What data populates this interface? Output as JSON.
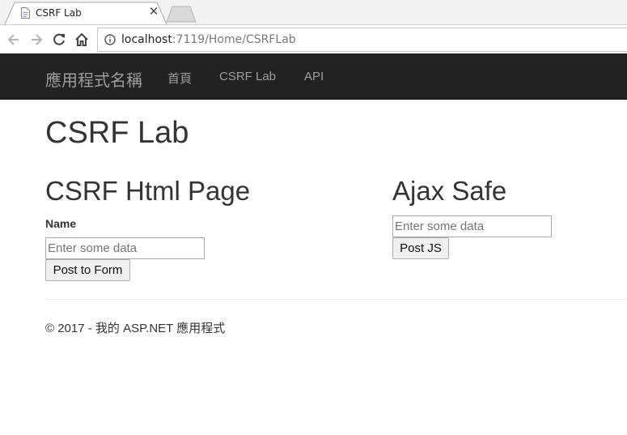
{
  "browser": {
    "tab_title": "CSRF Lab",
    "url_host": "localhost",
    "url_path": ":7119/Home/CSRFLab"
  },
  "navbar": {
    "brand": "應用程式名稱",
    "links": [
      {
        "label": "首頁"
      },
      {
        "label": "CSRF Lab"
      },
      {
        "label": "API"
      }
    ]
  },
  "main": {
    "title": "CSRF Lab",
    "form_section": {
      "title": "CSRF Html Page",
      "name_label": "Name",
      "input_placeholder": "Enter some data",
      "input_value": "",
      "button_label": "Post to Form"
    },
    "ajax_section": {
      "title": "Ajax Safe",
      "input_placeholder": "Enter some data",
      "input_value": "",
      "button_label": "Post JS"
    }
  },
  "footer": {
    "text": "© 2017 - 我的 ASP.NET 應用程式"
  },
  "colors": {
    "navbar_bg": "#222222",
    "navbar_text": "#9d9d9d",
    "body_text": "#333333"
  }
}
